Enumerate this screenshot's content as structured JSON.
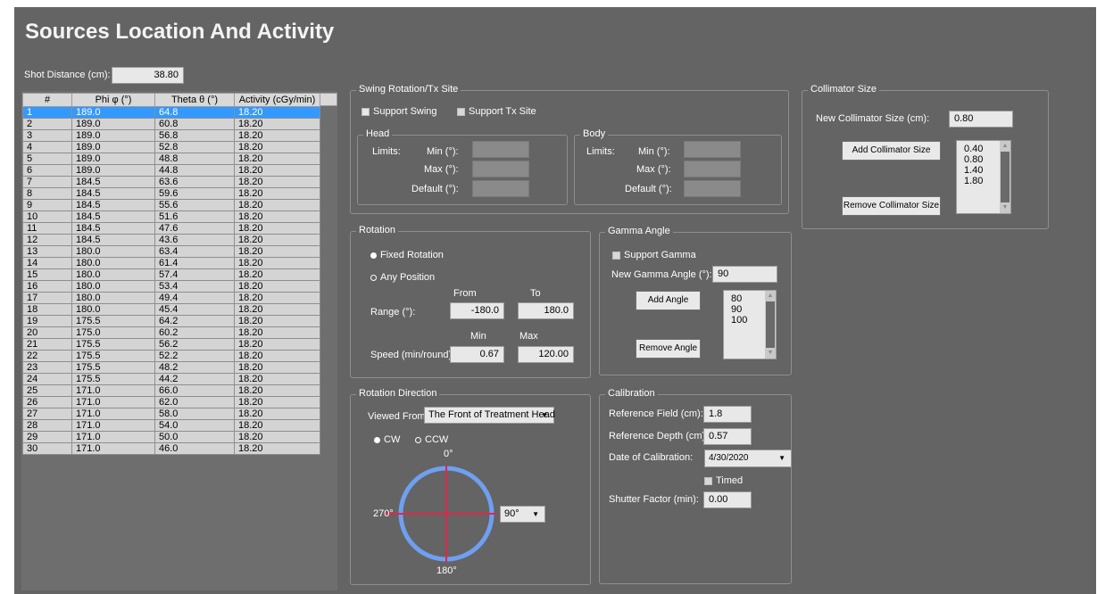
{
  "title": "Sources Location And Activity",
  "shot_distance": {
    "label": "Shot Distance (cm):",
    "value": "38.80"
  },
  "table": {
    "headers": [
      "#",
      "Phi φ (°)",
      "Theta θ (°)",
      "Activity (cGy/min)"
    ],
    "rows": [
      [
        "1",
        "189.0",
        "64.8",
        "18.20"
      ],
      [
        "2",
        "189.0",
        "60.8",
        "18.20"
      ],
      [
        "3",
        "189.0",
        "56.8",
        "18.20"
      ],
      [
        "4",
        "189.0",
        "52.8",
        "18.20"
      ],
      [
        "5",
        "189.0",
        "48.8",
        "18.20"
      ],
      [
        "6",
        "189.0",
        "44.8",
        "18.20"
      ],
      [
        "7",
        "184.5",
        "63.6",
        "18.20"
      ],
      [
        "8",
        "184.5",
        "59.6",
        "18.20"
      ],
      [
        "9",
        "184.5",
        "55.6",
        "18.20"
      ],
      [
        "10",
        "184.5",
        "51.6",
        "18.20"
      ],
      [
        "11",
        "184.5",
        "47.6",
        "18.20"
      ],
      [
        "12",
        "184.5",
        "43.6",
        "18.20"
      ],
      [
        "13",
        "180.0",
        "63.4",
        "18.20"
      ],
      [
        "14",
        "180.0",
        "61.4",
        "18.20"
      ],
      [
        "15",
        "180.0",
        "57.4",
        "18.20"
      ],
      [
        "16",
        "180.0",
        "53.4",
        "18.20"
      ],
      [
        "17",
        "180.0",
        "49.4",
        "18.20"
      ],
      [
        "18",
        "180.0",
        "45.4",
        "18.20"
      ],
      [
        "19",
        "175.5",
        "64.2",
        "18.20"
      ],
      [
        "20",
        "175.0",
        "60.2",
        "18.20"
      ],
      [
        "21",
        "175.5",
        "56.2",
        "18.20"
      ],
      [
        "22",
        "175.5",
        "52.2",
        "18.20"
      ],
      [
        "23",
        "175.5",
        "48.2",
        "18.20"
      ],
      [
        "24",
        "175.5",
        "44.2",
        "18.20"
      ],
      [
        "25",
        "171.0",
        "66.0",
        "18.20"
      ],
      [
        "26",
        "171.0",
        "62.0",
        "18.20"
      ],
      [
        "27",
        "171.0",
        "58.0",
        "18.20"
      ],
      [
        "28",
        "171.0",
        "54.0",
        "18.20"
      ],
      [
        "29",
        "171.0",
        "50.0",
        "18.20"
      ],
      [
        "30",
        "171.0",
        "46.0",
        "18.20"
      ]
    ],
    "selected_row": 0
  },
  "swing": {
    "title": "Swing Rotation/Tx Site",
    "support_swing": "Support Swing",
    "support_tx": "Support Tx Site",
    "head": {
      "title": "Head",
      "limits": "Limits:",
      "min": "Min (°):",
      "max": "Max (°):",
      "default": "Default (°):"
    },
    "body": {
      "title": "Body",
      "limits": "Limits:",
      "min": "Min (°):",
      "max": "Max (°):",
      "default": "Default (°):"
    }
  },
  "rotation": {
    "title": "Rotation",
    "fixed": "Fixed Rotation",
    "any": "Any Position",
    "from": "From",
    "to": "To",
    "range_label": "Range (°):",
    "range_from": "-180.0",
    "range_to": "180.0",
    "min": "Min",
    "max": "Max",
    "speed_label": "Speed (min/round):",
    "speed_min": "0.67",
    "speed_max": "120.00"
  },
  "gamma": {
    "title": "Gamma Angle",
    "support": "Support Gamma",
    "new_label": "New Gamma Angle (°):",
    "new_value": "90",
    "add": "Add Angle",
    "remove": "Remove Angle",
    "list": [
      "80",
      "90",
      "100"
    ]
  },
  "direction": {
    "title": "Rotation Direction",
    "viewed_label": "Viewed From:",
    "viewed_value": "The Front of Treatment Head",
    "cw": "CW",
    "ccw": "CCW",
    "a0": "0°",
    "a90": "90°",
    "a180": "180°",
    "a270": "270°",
    "angle_select": "90°",
    "circle_color": "#6f9ff0",
    "cross_color": "#e2264a"
  },
  "calibration": {
    "title": "Calibration",
    "ref_field_label": "Reference Field (cm):",
    "ref_field": "1.8",
    "ref_depth_label": "Reference Depth (cm):",
    "ref_depth": "0.57",
    "date_label": "Date of Calibration:",
    "date": "4/30/2020",
    "timed": "Timed",
    "shutter_label": "Shutter Factor (min):",
    "shutter": "0.00"
  },
  "collimator": {
    "title": "Collimator Size",
    "new_label": "New Collimator Size (cm):",
    "new_value": "0.80",
    "add": "Add Collimator Size",
    "remove": "Remove Collimator Size",
    "list": [
      "0.40",
      "0.80",
      "1.40",
      "1.80"
    ]
  }
}
